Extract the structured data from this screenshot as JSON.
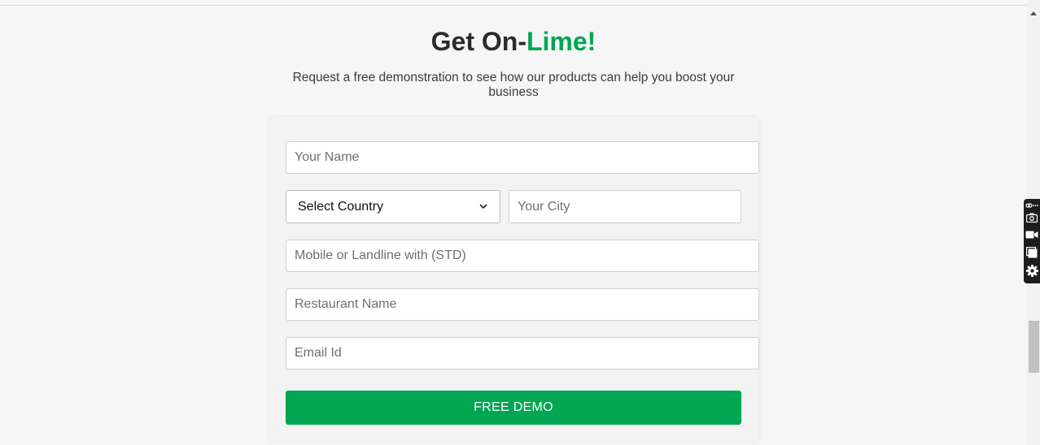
{
  "heading": {
    "part1": "Get On-",
    "part2": "Lime!"
  },
  "subtitle": "Request a free demonstration to see how our products can help you boost your business",
  "form": {
    "name_placeholder": "Your Name",
    "country_selected": "Select Country",
    "city_placeholder": "Your City",
    "phone_placeholder": "Mobile or Landline with (STD)",
    "restaurant_placeholder": "Restaurant Name",
    "email_placeholder": "Email Id",
    "submit_label": "FREE DEMO"
  },
  "extension_toolbar": {
    "icons": [
      "link-icon",
      "camera-icon",
      "video-camera-icon",
      "window-icon",
      "gear-icon"
    ]
  },
  "colors": {
    "accent": "#00a651",
    "heading": "#2b2b2b",
    "background": "#f6f6f6"
  }
}
